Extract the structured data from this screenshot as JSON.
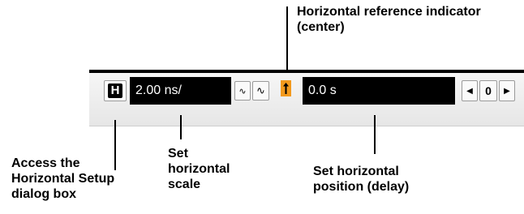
{
  "callouts": {
    "ref_indicator": [
      "Horizontal reference indicator",
      "(center)"
    ],
    "setup_dialog": [
      "Access the",
      "Horizontal Setup",
      "dialog box"
    ],
    "scale": [
      "Set",
      "horizontal",
      "scale"
    ],
    "position": [
      "Set horizontal",
      "position (delay)"
    ]
  },
  "toolbar": {
    "setup_button_label": "H",
    "scale_value": "2.00 ns/",
    "fine_glyph": "∿",
    "coarse_glyph": "∿",
    "position_value": "0.0 s",
    "left_glyph": "◀",
    "zero_label": "0",
    "right_glyph": "▶"
  },
  "colors": {
    "reference_indicator": "#f39a1e",
    "field_background": "#000000",
    "field_text": "#ffffff"
  },
  "icons": {
    "reference_indicator": "up-arrow-icon",
    "fine_adjust": "fine-adjust-icon",
    "coarse_adjust": "coarse-adjust-icon",
    "step_left": "arrow-left-icon",
    "step_right": "arrow-right-icon"
  }
}
